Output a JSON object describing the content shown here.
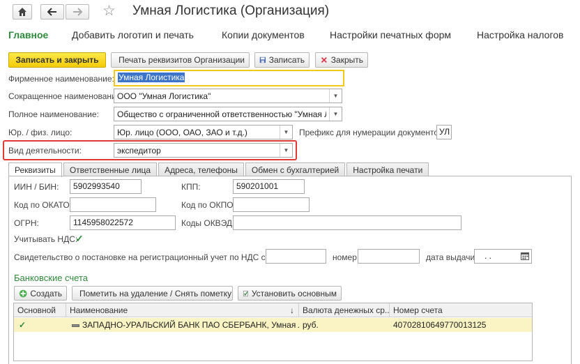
{
  "nav": {
    "home_icon": "home-icon",
    "back_icon": "arrow-left-icon",
    "forward_icon": "arrow-right-icon",
    "star_icon": "star-icon"
  },
  "window_title": "Умная Логистика (Организация)",
  "menu": [
    "Главное",
    "Добавить логотип и печать",
    "Копии документов",
    "Настройки печатных форм",
    "Настройка налогов"
  ],
  "toolbar": {
    "save_close": "Записать и закрыть",
    "print": "Печать реквизитов Организации",
    "save": "Записать",
    "close": "Закрыть"
  },
  "form": {
    "brand_name_label": "Фирменное наименование:",
    "brand_name_value": "Умная Логистика",
    "short_name_label": "Сокращенное наименование:",
    "short_name_value": "ООО \"Умная Логистика\"",
    "full_name_label": "Полное наименование:",
    "full_name_value": "Общество с ограниченной ответственностью \"Умная Логистика\"",
    "entity_label": "Юр. / физ. лицо:",
    "entity_value": "Юр. лицо (ООО, ОАО, ЗАО и т.д.)",
    "prefix_label": "Префикс для нумерации документов :",
    "prefix_value": "УЛ",
    "activity_label": "Вид деятельности:",
    "activity_value": "экспедитор"
  },
  "tabs": [
    "Реквизиты",
    "Ответственные лица",
    "Адреса, телефоны",
    "Обмен с бухгалтерией",
    "Настройка печати"
  ],
  "requisites": {
    "inn_label": "ИИН / БИН:",
    "inn_value": "5902993540",
    "kpp_label": "КПП:",
    "kpp_value": "590201001",
    "okato_label": "Код по ОКАТО:",
    "okato_value": "",
    "okpo_label": "Код по ОКПО:",
    "okpo_value": "",
    "ogrn_label": "ОГРН:",
    "ogrn_value": "1145958022572",
    "okved_label": "Коды ОКВЭД:",
    "okved_value": "",
    "vat_label": "Учитывать НДС:",
    "cert_label": "Свидетельство о постановке на регистрационный учет по НДС серия:",
    "cert_series": "",
    "number_label": "номер:",
    "number_value": "",
    "date_label": "дата выдачи:",
    "date_value": ". ."
  },
  "bank": {
    "section_title": "Банковские счета",
    "create": "Создать",
    "mark_delete": "Пометить на удаление / Снять пометку",
    "set_main": "Установить основным",
    "columns": [
      "Основной",
      "Наименование",
      "Валюта денежных ср...",
      "Номер счета"
    ],
    "sort_indicator": "↓",
    "rows": [
      {
        "main": "✓",
        "name": "ЗАПАДНО-УРАЛЬСКИЙ БАНК ПАО СБЕРБАНК, Умная Логистика",
        "currency": "руб.",
        "account": "40702810649770013125"
      }
    ]
  }
}
